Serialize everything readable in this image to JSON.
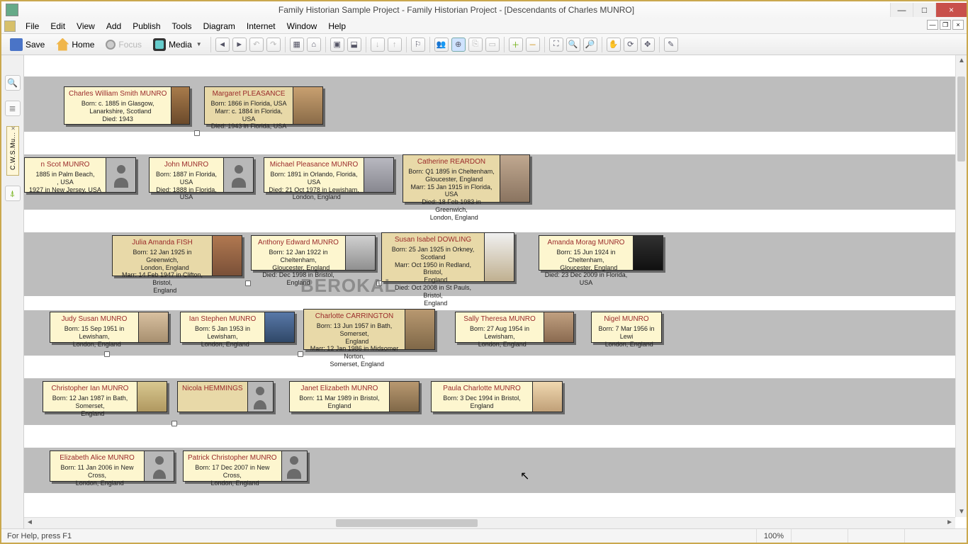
{
  "window": {
    "title": "Family Historian Sample Project - Family Historian Project - [Descendants of Charles MUNRO]",
    "min": "—",
    "max": "□",
    "close": "×"
  },
  "menu": [
    "File",
    "Edit",
    "View",
    "Add",
    "Publish",
    "Tools",
    "Diagram",
    "Internet",
    "Window",
    "Help"
  ],
  "toolbar": {
    "save": "Save",
    "home": "Home",
    "focus": "Focus",
    "media": "Media"
  },
  "sidebar": {
    "tab": "C.W.S.Mu..."
  },
  "status": {
    "help": "For Help, press F1",
    "zoom": "100%"
  },
  "watermark": "BEROKAL",
  "people": {
    "p1": {
      "name": "Charles William Smith MUNRO",
      "lines": "Born: c. 1885 in Glasgow,\n   Lanarkshire, Scotland\nDied: 1943"
    },
    "p2": {
      "name": "Margaret PLEASANCE",
      "lines": "Born: 1866 in Florida, USA\nMarr: c. 1884 in Florida, USA\nDied: 1943 in Florida, USA"
    },
    "p3": {
      "name": "n Scot MUNRO",
      "lines": "1885 in Palm Beach,\n, USA\n1927 in New Jersey, USA"
    },
    "p4": {
      "name": "John MUNRO",
      "lines": "Born: 1887 in Florida, USA\nDied: 1888 in Florida, USA"
    },
    "p5": {
      "name": "Michael Pleasance MUNRO",
      "lines": "Born: 1891 in Orlando, Florida, USA\nDied: 21 Oct 1978 in Lewisham,\n   London, England"
    },
    "p6": {
      "name": "Catherine REARDON",
      "lines": "Born: Q1 1895 in Cheltenham,\n   Gloucester, England\nMarr: 15 Jan 1915 in Florida, USA\nDied: 18 Feb 1983 in Greenwich,\n   London, England"
    },
    "p7": {
      "name": "Julia Amanda FISH",
      "lines": "Born: 12 Jan 1925 in Greenwich,\n   London, England\nMarr: 14 Feb 1947 in Clifton, Bristol,\n   England"
    },
    "p8": {
      "name": "Anthony Edward MUNRO",
      "lines": "Born: 12 Jan 1922 in Cheltenham,\n   Gloucester, England\nDied: Dec 1998 in Bristol, England"
    },
    "p9": {
      "name": "Susan Isabel DOWLING",
      "lines": "Born: 25 Jan 1925 in Orkney, Scotland\nMarr: Oct 1950 in Redland, Bristol,\n   England\nDied: Oct 2008 in St Pauls, Bristol,\n   England"
    },
    "p10": {
      "name": "Amanda Morag MUNRO",
      "lines": "Born: 15 Jun 1924 in Cheltenham,\n   Gloucester, England\nDied: 23 Dec 2009 in Florida, USA"
    },
    "p11": {
      "name": "Judy Susan MUNRO",
      "lines": "Born: 15 Sep 1951 in Lewisham,\n   London, England"
    },
    "p12": {
      "name": "Ian Stephen MUNRO",
      "lines": "Born: 5 Jan 1953 in Lewisham,\n   London, England"
    },
    "p13": {
      "name": "Charlotte CARRINGTON",
      "lines": "Born: 13 Jun 1957 in Bath, Somerset,\n   England\nMarr: 12 Jan 1986 in Midsomer Norton,\n   Somerset, England"
    },
    "p14": {
      "name": "Sally Theresa MUNRO",
      "lines": "Born: 27 Aug 1954 in Lewisham,\n   London, England"
    },
    "p15": {
      "name": "Nigel MUNRO",
      "lines": "Born: 7 Mar 1956 in Lewi\n   London, England"
    },
    "p16": {
      "name": "Christopher Ian MUNRO",
      "lines": "Born: 12 Jan 1987 in Bath, Somerset,\n   England"
    },
    "p17": {
      "name": "Nicola HEMMINGS",
      "lines": ""
    },
    "p18": {
      "name": "Janet Elizabeth MUNRO",
      "lines": "Born: 11 Mar 1989 in Bristol, England"
    },
    "p19": {
      "name": "Paula Charlotte MUNRO",
      "lines": "Born: 3 Dec 1994 in Bristol, England"
    },
    "p20": {
      "name": "Elizabeth Alice MUNRO",
      "lines": "Born: 11 Jan 2006 in New Cross,\n   London, England"
    },
    "p21": {
      "name": "Patrick Christopher MUNRO",
      "lines": "Born: 17 Dec 2007 in New Cross,\n   London, England"
    }
  }
}
